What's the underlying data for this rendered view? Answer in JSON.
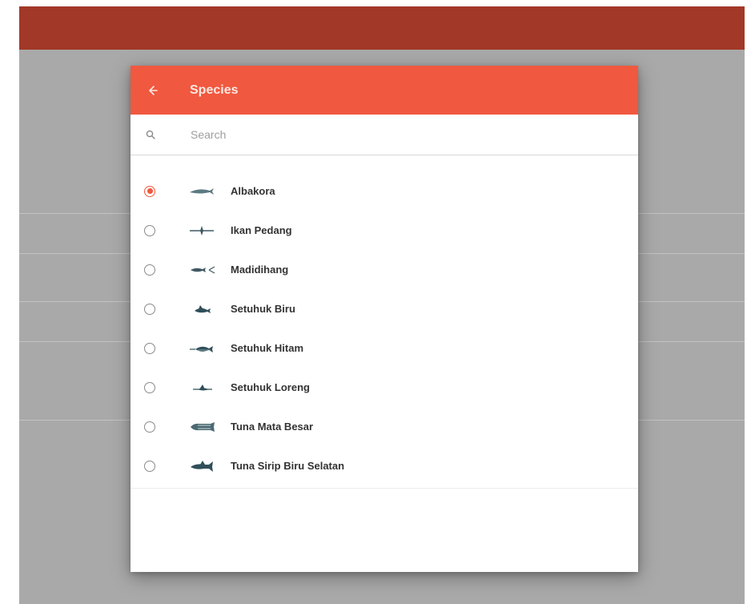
{
  "dialog": {
    "title": "Species",
    "search_placeholder": "Search",
    "selected_index": 0
  },
  "species": [
    {
      "label": "Albakora",
      "icon": "albacore-fish-icon",
      "selected": true
    },
    {
      "label": "Ikan Pedang",
      "icon": "swordfish-icon",
      "selected": false
    },
    {
      "label": "Madidihang",
      "icon": "yellowfin-tuna-icon",
      "selected": false
    },
    {
      "label": "Setuhuk Biru",
      "icon": "blue-marlin-icon",
      "selected": false
    },
    {
      "label": "Setuhuk Hitam",
      "icon": "black-marlin-icon",
      "selected": false
    },
    {
      "label": "Setuhuk Loreng",
      "icon": "striped-marlin-icon",
      "selected": false
    },
    {
      "label": "Tuna Mata Besar",
      "icon": "bigeye-tuna-icon",
      "selected": false
    },
    {
      "label": "Tuna Sirip Biru Selatan",
      "icon": "southern-bluefin-tuna-icon",
      "selected": false
    }
  ],
  "colors": {
    "app_bar": "#a23828",
    "dialog_header": "#f0583f",
    "radio_selected": "#f0583f",
    "backdrop": "#a9a9a9"
  }
}
